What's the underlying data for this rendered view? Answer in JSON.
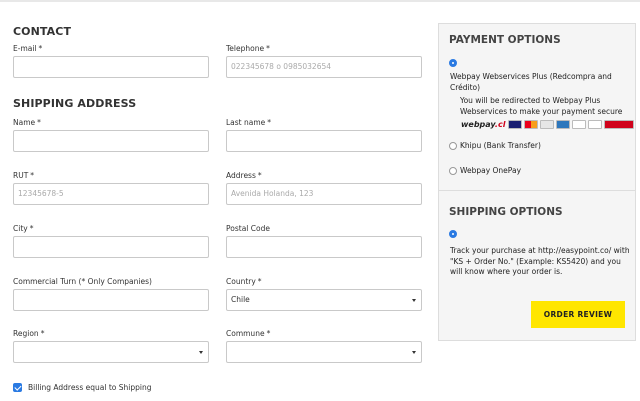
{
  "contact": {
    "title": "CONTACT",
    "email": {
      "label": "E-mail",
      "value": ""
    },
    "telephone": {
      "label": "Telephone",
      "placeholder": "022345678 o 0985032654"
    }
  },
  "shipping": {
    "title": "SHIPPING ADDRESS",
    "name": {
      "label": "Name",
      "value": ""
    },
    "last_name": {
      "label": "Last name",
      "value": ""
    },
    "rut": {
      "label": "RUT",
      "placeholder": "12345678-5"
    },
    "address": {
      "label": "Address",
      "placeholder": "Avenida Holanda, 123"
    },
    "city": {
      "label": "City",
      "value": ""
    },
    "postal_code": {
      "label": "Postal Code",
      "value": ""
    },
    "commercial_turn": {
      "label": "Commercial Turn (* Only Companies)",
      "value": ""
    },
    "country": {
      "label": "Country",
      "value": "Chile"
    },
    "region": {
      "label": "Region",
      "value": ""
    },
    "commune": {
      "label": "Commune",
      "value": ""
    }
  },
  "required_mark": "*",
  "billing": {
    "label": "Billing Address equal to Shipping",
    "checked": true
  },
  "payment": {
    "title": "PAYMENT OPTIONS",
    "options": [
      {
        "label": "Webpay Webservices Plus (Redcompra and Crédito)",
        "selected": true
      },
      {
        "label": "Khipu (Bank Transfer)",
        "selected": false
      },
      {
        "label": "Webpay OnePay",
        "selected": false
      }
    ],
    "redirect_note": "You will be redirected to Webpay Plus Webservices to make your payment secure",
    "webpay_logo_a": "webpay",
    "webpay_logo_b": ".cl",
    "cards": [
      "visa-icon",
      "mastercard-icon",
      "magna-icon",
      "amex-icon",
      "diners-icon",
      "redcompra-icon",
      "redcompra-logo-icon"
    ]
  },
  "shipping_options": {
    "title": "SHIPPING OPTIONS",
    "note": "Track your purchase at http://easypoint.co/ with \"KS + Order No.\" (Example: KS5420) and you will know where your order is."
  },
  "order_review_label": "ORDER REVIEW",
  "colors": {
    "accent": "#2a7ae2",
    "button": "#ffe600",
    "panel_bg": "#f5f5f5"
  }
}
